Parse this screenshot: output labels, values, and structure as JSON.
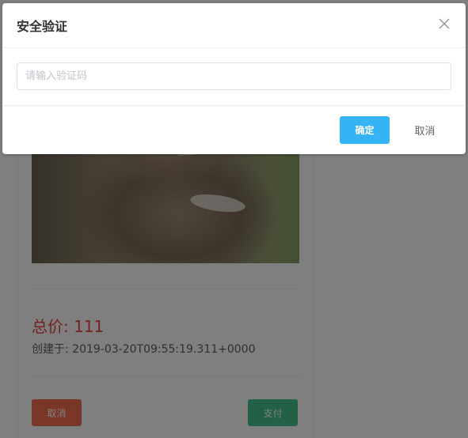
{
  "dialog": {
    "title": "安全验证",
    "close_icon": "close-icon",
    "code_input": {
      "placeholder": "请输入验证码",
      "value": ""
    },
    "confirm_label": "确定",
    "cancel_label": "取消"
  },
  "order_card": {
    "price_label": "总价: 111",
    "created_label": "创建于: 2019-03-20T09:55:19.311+0000",
    "cancel_label": "取消",
    "pay_label": "支付"
  },
  "colors": {
    "primary": "#36b3f4",
    "danger": "#f56c4c",
    "success": "#44c28a",
    "price": "#e6453b",
    "overlay": "rgba(0,0,0,0.5)"
  }
}
